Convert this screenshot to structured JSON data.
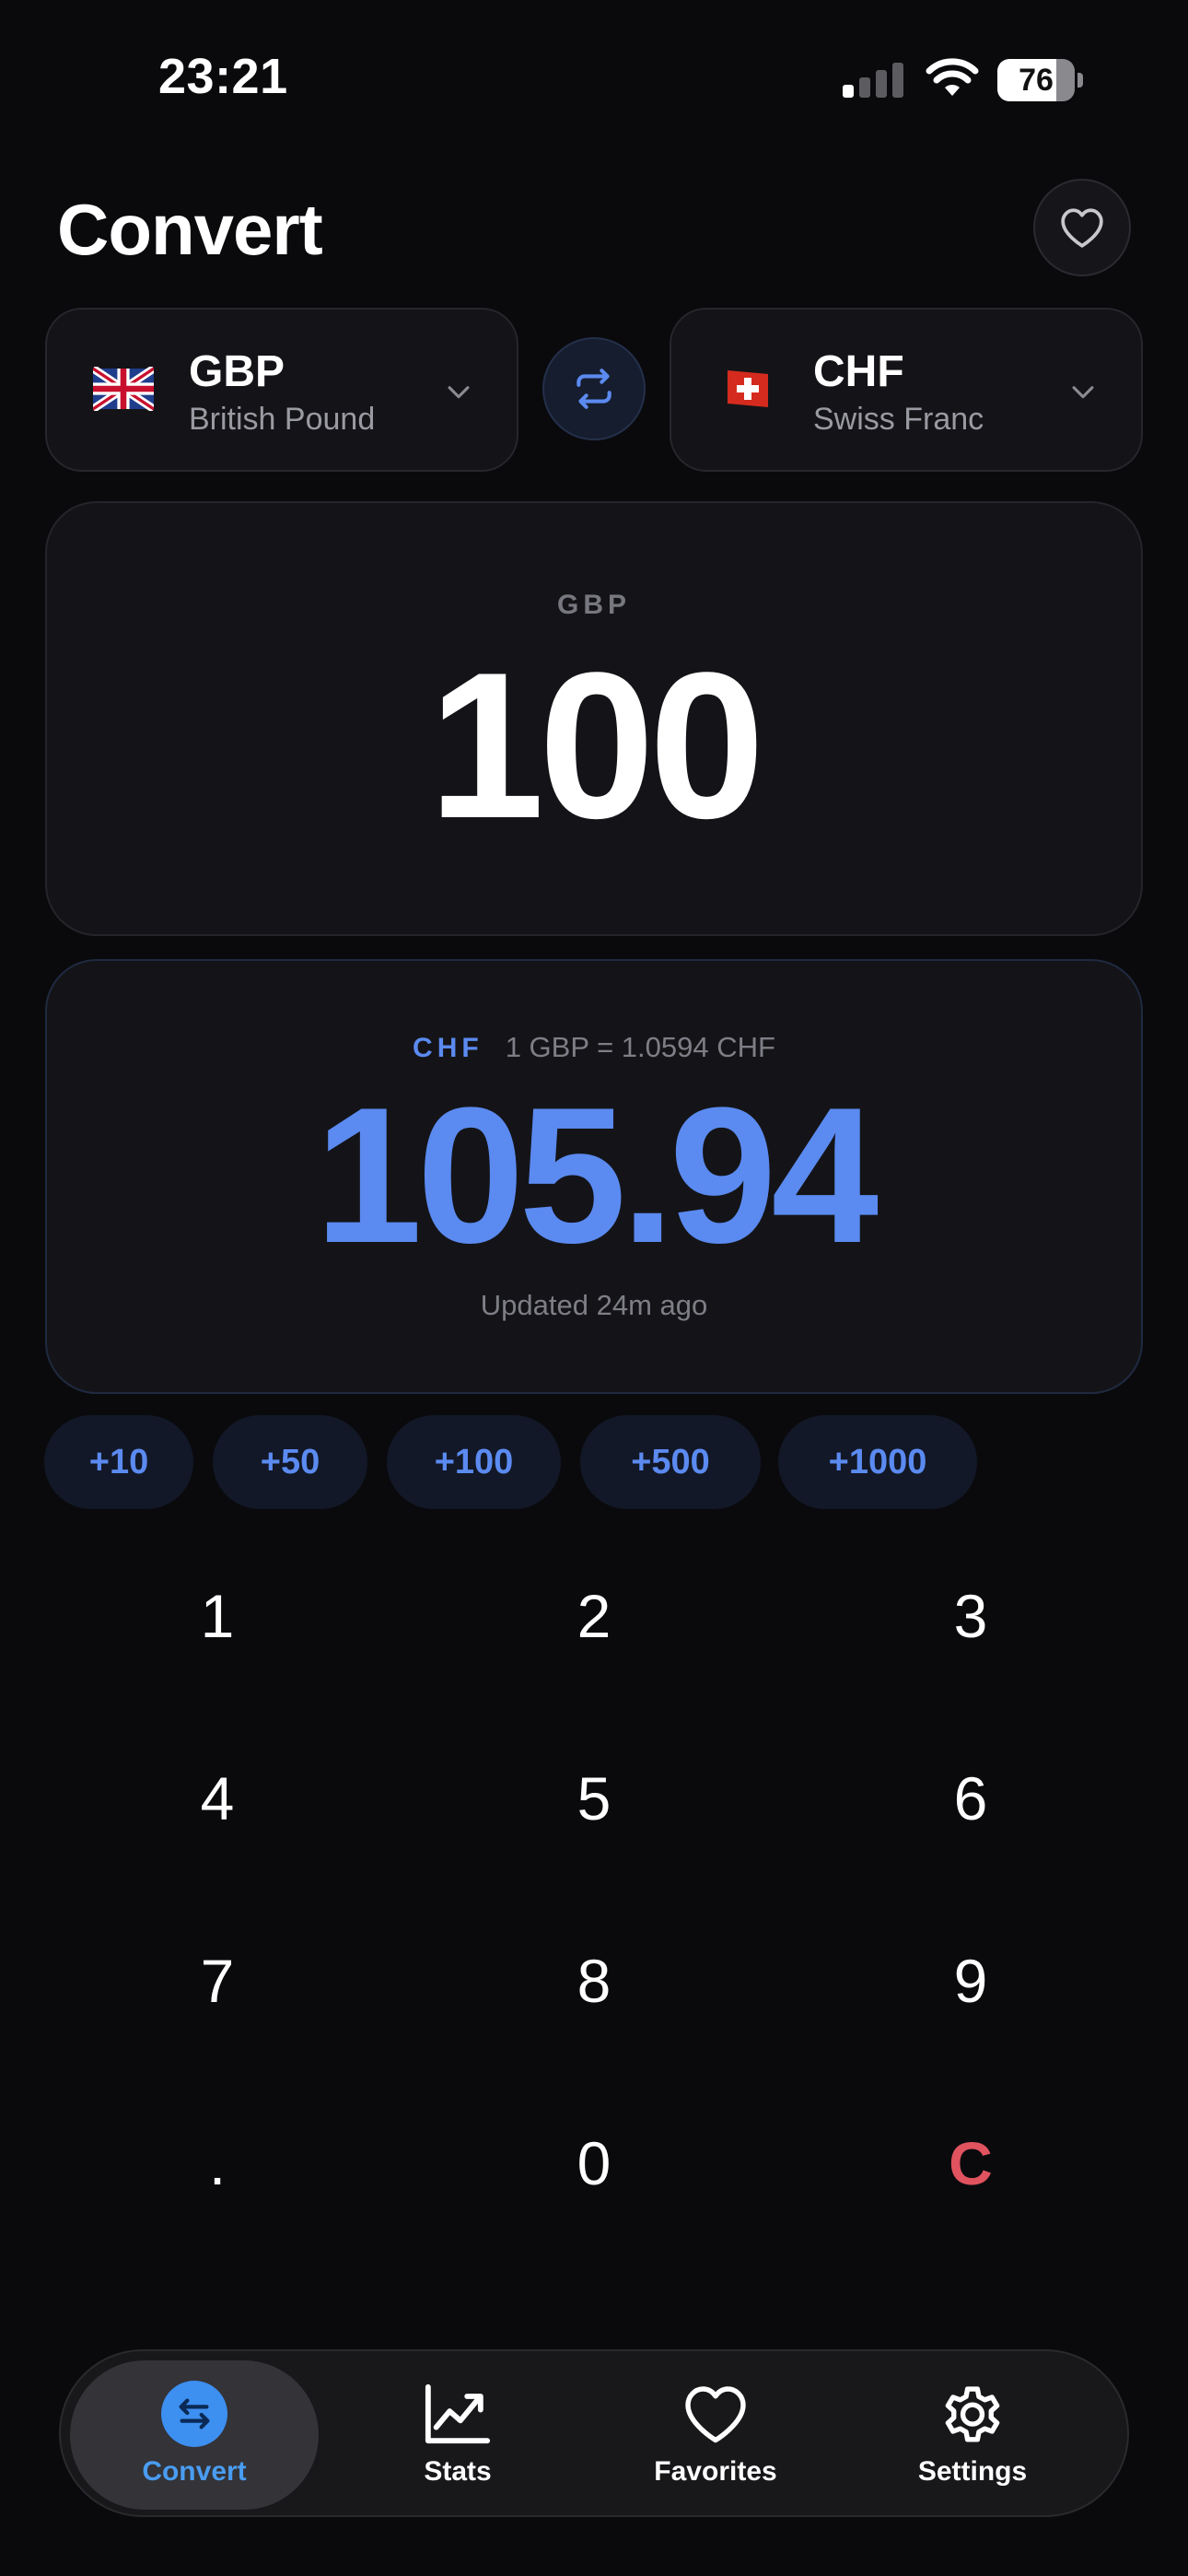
{
  "status_bar": {
    "time": "23:21",
    "battery_percent": "76",
    "battery_level": 0.76,
    "signal_bars_active": 1,
    "signal_bars_total": 4
  },
  "header": {
    "title": "Convert",
    "favorite_icon": "heart-outline-icon"
  },
  "from_currency": {
    "code": "GBP",
    "name": "British Pound",
    "flag": "uk-flag"
  },
  "to_currency": {
    "code": "CHF",
    "name": "Swiss Franc",
    "flag": "swiss-flag"
  },
  "swap_icon": "swap-arrows-icon",
  "input": {
    "currency_label": "GBP",
    "amount": "100"
  },
  "result": {
    "currency_label": "CHF",
    "rate_text": "1 GBP = 1.0594 CHF",
    "amount": "105.94",
    "updated_text": "Updated 24m ago"
  },
  "quick_add": [
    "+10",
    "+50",
    "+100",
    "+500",
    "+1000"
  ],
  "keypad": [
    "1",
    "2",
    "3",
    "4",
    "5",
    "6",
    "7",
    "8",
    "9",
    ".",
    "0",
    "C"
  ],
  "tab_bar": {
    "tabs": [
      {
        "label": "Convert",
        "icon": "convert-icon",
        "active": true
      },
      {
        "label": "Stats",
        "icon": "chart-icon",
        "active": false
      },
      {
        "label": "Favorites",
        "icon": "heart-icon",
        "active": false
      },
      {
        "label": "Settings",
        "icon": "gear-icon",
        "active": false
      }
    ]
  },
  "colors": {
    "background": "#0a0a0d",
    "accent_blue": "#5b8af0",
    "clear_red": "#e0535f",
    "active_tab_blue": "#3d8ff0"
  }
}
